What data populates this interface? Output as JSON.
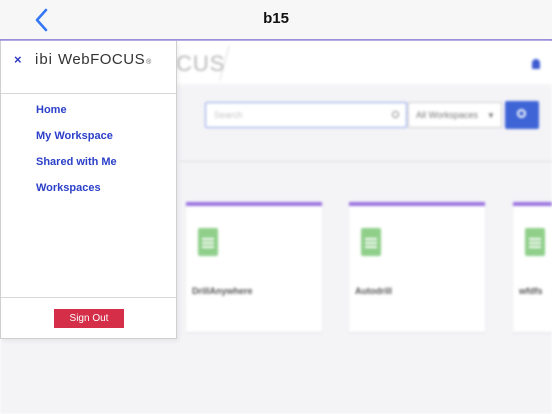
{
  "navbar": {
    "title": "b15",
    "back_icon": "chevron-left-icon",
    "accent": "#8e7fd6"
  },
  "drawer": {
    "close_glyph": "×",
    "brand_prefix": "ibi",
    "brand_name": "WebFOCUS",
    "brand_reg": "®",
    "menu": [
      {
        "label": "Home"
      },
      {
        "label": "My Workspace"
      },
      {
        "label": "Shared with Me"
      },
      {
        "label": "Workspaces"
      }
    ],
    "signout_label": "Sign Out",
    "link_color": "#2c40c9",
    "signout_color": "#d42e48"
  },
  "background": {
    "logo_fragment": "CUS",
    "search_placeholder": "Search",
    "workspace_filter": "All Workspaces",
    "cards": [
      {
        "label": "DrillAnywhere"
      },
      {
        "label": "Autodrill"
      },
      {
        "label": "wfdfs"
      }
    ]
  }
}
